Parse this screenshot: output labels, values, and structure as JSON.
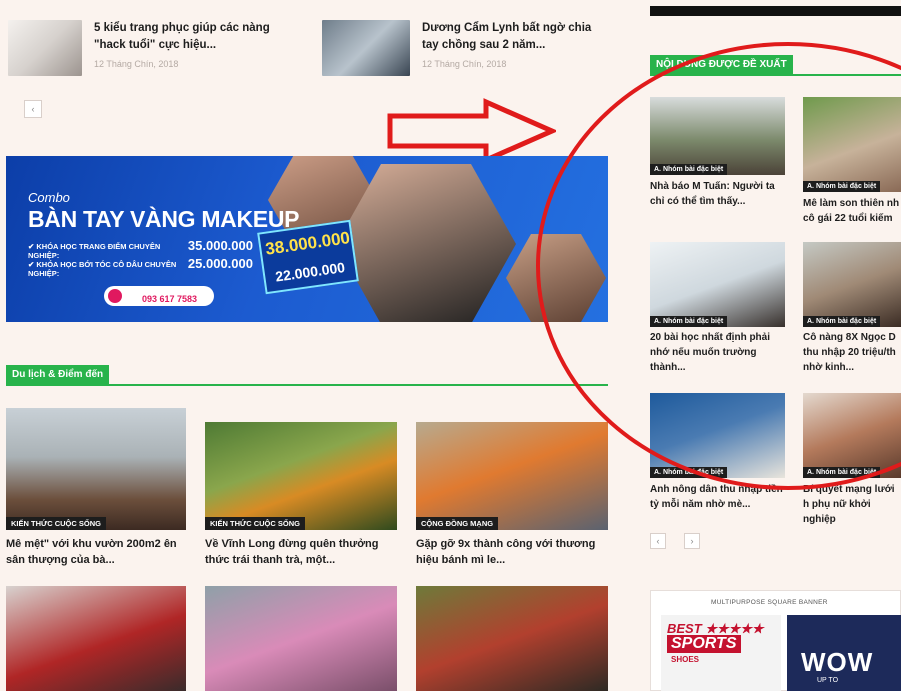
{
  "top_posts": [
    {
      "title": "5 kiểu trang phục giúp các nàng \"hack tuổi\" cực hiệu...",
      "date": "12 Tháng Chín, 2018"
    },
    {
      "title": "Dương Cẩm Lynh bất ngờ chia tay chồng sau 2 năm...",
      "date": "12 Tháng Chín, 2018"
    }
  ],
  "banner": {
    "combo": "Combo",
    "headline": "BÀN TAY VÀNG MAKEUP",
    "course1_label": "✔ KHÓA HỌC TRANG ĐIỂM CHUYÊN NGHIỆP:",
    "course1_price": "35.000.000",
    "course2_label": "✔ KHÓA HỌC BỚI TÓC CÔ DÂU CHUYÊN NGHIỆP:",
    "course2_price": "25.000.000",
    "hotline": "093 617 7583",
    "old_total": "38.000.000",
    "new_total": "22.000.000"
  },
  "section": {
    "title": "Du lịch & Điểm đến"
  },
  "grid_cards": [
    {
      "tag": "KIẾN THỨC CUỘC SỐNG",
      "title": "Mê mệt\" với khu vườn 200m2 ên sân thượng của bà..."
    },
    {
      "tag": "KIẾN THỨC CUỘC SỐNG",
      "title": "Về Vĩnh Long đừng quên thưởng thức trái thanh trà, một..."
    },
    {
      "tag": "CỘNG ĐỒNG MẠNG",
      "title": "Gặp gỡ 9x thành công với thương hiệu bánh mì le..."
    }
  ],
  "sidebar": {
    "header": "NỘI DUNG ĐƯỢC ĐỀ XUẤT",
    "items": [
      {
        "tag": "A. Nhóm bài đặc biệt",
        "title": "Nhà báo M Tuấn: Người ta chỉ có thể tìm thấy..."
      },
      {
        "tag": "A. Nhóm bài đặc biệt",
        "title": "Mê làm son thiên nh cô gái 22 tuổi kiếm"
      },
      {
        "tag": "A. Nhóm bài đặc biệt",
        "title": "20 bài học nhất định phải nhớ nếu muốn trường thành..."
      },
      {
        "tag": "A. Nhóm bài đặc biệt",
        "title": "Cô nàng 8X Ngọc D thu nhập 20 triệu/th nhờ kinh..."
      },
      {
        "tag": "A. Nhóm bài đặc biệt",
        "title": "Anh nông dân thu nhập tiền tỷ mỗi năm nhờ mè..."
      },
      {
        "tag": "A. Nhóm bài đặc biệt",
        "title": "Bí quyết mạng lưới h phụ nữ khởi nghiệp"
      }
    ]
  },
  "ad": {
    "label": "MULTIPURPOSE SQUARE BANNER",
    "best": "BEST ★★★★★",
    "sports": "SPORTS",
    "shoes": "SHOES",
    "wow": "WOW",
    "up_to": "UP TO"
  },
  "pager": {
    "prev": "‹",
    "next": "›"
  },
  "colors": {
    "accent_green": "#28b34b",
    "annotation_red": "#e01b1b"
  }
}
